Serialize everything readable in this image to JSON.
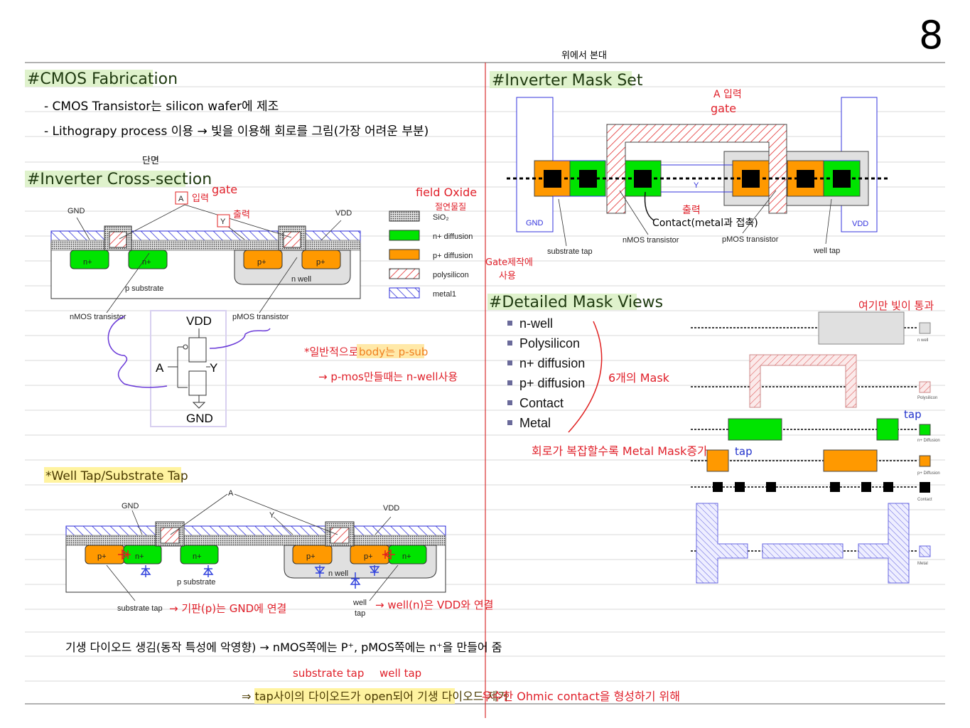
{
  "page_number": "8",
  "colors": {
    "n_diffusion": "#00e400",
    "p_diffusion": "#ff9900",
    "n_well": "#e0e0e0",
    "metal": "#3333dd",
    "poly": "#e02020",
    "highlight_green": "#dff2cc",
    "highlight_yellow": "#fff3a0",
    "margin_line": "#d83030"
  },
  "fabrication": {
    "title": "#CMOS Fabrication",
    "bullets": [
      "- CMOS Transistor는 silicon wafer에 제조",
      "- Lithograpy process 이용 → 빛을 이용해 회로를 그림(가장 어려운 부분)"
    ]
  },
  "cross_section": {
    "title": "#Inverter Cross-section",
    "title_note": "단면",
    "labels": {
      "gnd": "GND",
      "vdd": "VDD",
      "a": "A",
      "y": "Y",
      "n_plus": "n+",
      "p_plus": "p+",
      "n_well": "n well",
      "p_substrate": "p substrate",
      "nmos": "nMOS transistor",
      "pmos": "pMOS transistor"
    },
    "notes": {
      "input": "입력",
      "gate": "gate",
      "output": "출력",
      "field_oxide": "field Oxide",
      "insulator": "절연물질",
      "gate_making": "Gate제작에",
      "use": "사용"
    },
    "legend": [
      "SiO₂",
      "n+ diffusion",
      "p+ diffusion",
      "polysilicon",
      "metal1"
    ],
    "schematic": {
      "vdd": "VDD",
      "gnd": "GND",
      "a": "A",
      "y": "Y"
    },
    "body_note": [
      "*일반적으로",
      "body는 p-sub",
      "→ p-mos만들때는 n-well사용"
    ]
  },
  "well_tap": {
    "title": "*Well Tap/Substrate Tap",
    "labels": {
      "a": "A",
      "gnd": "GND",
      "y": "Y",
      "vdd": "VDD",
      "p_plus": "p+",
      "n_plus": "n+",
      "n_well": "n well",
      "p_substrate": "p substrate",
      "substrate_tap": "substrate tap",
      "well": "well",
      "tap": "tap"
    },
    "notes": {
      "substrate": "→ 기판(p)는 GND에 연결",
      "well": "→ well(n)은 VDD와 연결"
    }
  },
  "bottom_notes": {
    "line1": "기생 다이오드 생김(동작 특성에 악영향) → nMOS쪽에는 P⁺, pMOS쪽에는 n⁺을 만들어 줌",
    "substrate_tap": "substrate tap",
    "well_tap": "well tap",
    "line2": "⇒ tap사이의 다이오드가 open되어 기생 다이오드 제거",
    "line2_note": "우수한 Ohmic contact을 형성하기 위해"
  },
  "mask_set": {
    "title": "#Inverter Mask Set",
    "title_note": "위에서 본대",
    "labels": {
      "gnd": "GND",
      "vdd": "VDD",
      "y": "Y",
      "substrate_tap": "substrate tap",
      "nmos": "nMOS transistor",
      "pmos": "pMOS transistor",
      "well_tap": "well tap"
    },
    "notes": {
      "a_input": "A 입력",
      "gate": "gate",
      "output": "출력",
      "contact": "Contact(metal과 접촉)"
    }
  },
  "detailed": {
    "title": "#Detailed Mask Views",
    "items": [
      "n-well",
      "Polysilicon",
      "n+ diffusion",
      "p+ diffusion",
      "Contact",
      "Metal"
    ],
    "mask_count_note": "6개의 Mask",
    "metal_note": "회로가 복잡할수록 Metal Mask증가",
    "light_note": "여기만 빛이 통과",
    "tap": "tap",
    "legend": [
      "n well",
      "Polysilicon",
      "n+ Diffusion",
      "p+ Diffusion",
      "Contact",
      "Metal"
    ]
  }
}
